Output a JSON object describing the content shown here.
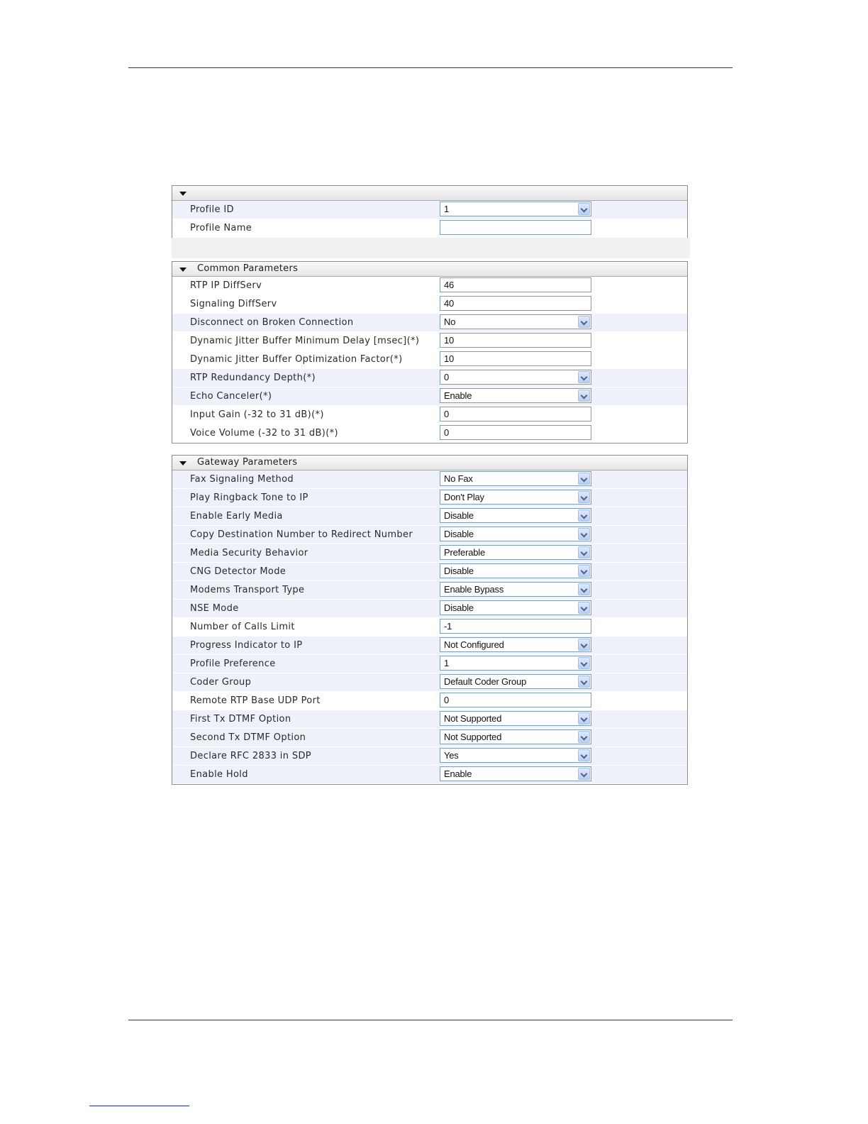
{
  "profile_section": {
    "title": "",
    "rows": [
      {
        "label": "Profile ID",
        "value": "1",
        "type": "select"
      },
      {
        "label": "Profile Name",
        "value": "",
        "type": "text"
      }
    ]
  },
  "common_section": {
    "title": "Common Parameters",
    "rows": [
      {
        "label": "RTP IP DiffServ",
        "value": "46",
        "type": "text"
      },
      {
        "label": "Signaling DiffServ",
        "value": "40",
        "type": "text"
      },
      {
        "label": "Disconnect on Broken Connection",
        "value": "No",
        "type": "select"
      },
      {
        "label": "Dynamic Jitter Buffer Minimum Delay [msec](*)",
        "value": "10",
        "type": "text"
      },
      {
        "label": "Dynamic Jitter Buffer Optimization Factor(*)",
        "value": "10",
        "type": "text"
      },
      {
        "label": "RTP Redundancy Depth(*)",
        "value": "0",
        "type": "select"
      },
      {
        "label": "Echo Canceler(*)",
        "value": "Enable",
        "type": "select"
      },
      {
        "label": "Input Gain (-32 to 31 dB)(*)",
        "value": "0",
        "type": "text"
      },
      {
        "label": "Voice Volume (-32 to 31 dB)(*)",
        "value": "0",
        "type": "text"
      }
    ]
  },
  "gateway_section": {
    "title": "Gateway Parameters",
    "rows": [
      {
        "label": "Fax Signaling Method",
        "value": "No Fax",
        "type": "select"
      },
      {
        "label": "Play Ringback Tone to IP",
        "value": "Don't Play",
        "type": "select"
      },
      {
        "label": "Enable Early Media",
        "value": "Disable",
        "type": "select"
      },
      {
        "label": "Copy Destination Number to Redirect Number",
        "value": "Disable",
        "type": "select"
      },
      {
        "label": "Media Security Behavior",
        "value": "Preferable",
        "type": "select"
      },
      {
        "label": "CNG Detector Mode",
        "value": "Disable",
        "type": "select"
      },
      {
        "label": "Modems Transport Type",
        "value": "Enable Bypass",
        "type": "select"
      },
      {
        "label": "NSE Mode",
        "value": "Disable",
        "type": "select"
      },
      {
        "label": "Number of Calls Limit",
        "value": "-1",
        "type": "text"
      },
      {
        "label": "Progress Indicator to IP",
        "value": "Not Configured",
        "type": "select"
      },
      {
        "label": "Profile Preference",
        "value": "1",
        "type": "select"
      },
      {
        "label": "Coder Group",
        "value": "Default Coder Group",
        "type": "select"
      },
      {
        "label": "Remote RTP Base UDP Port",
        "value": "0",
        "type": "text"
      },
      {
        "label": "First Tx DTMF Option",
        "value": "Not Supported",
        "type": "select"
      },
      {
        "label": "Second Tx DTMF Option",
        "value": "Not Supported",
        "type": "select"
      },
      {
        "label": "Declare RFC 2833 in SDP",
        "value": "Yes",
        "type": "select"
      },
      {
        "label": "Enable Hold",
        "value": "Enable",
        "type": "select"
      }
    ]
  }
}
